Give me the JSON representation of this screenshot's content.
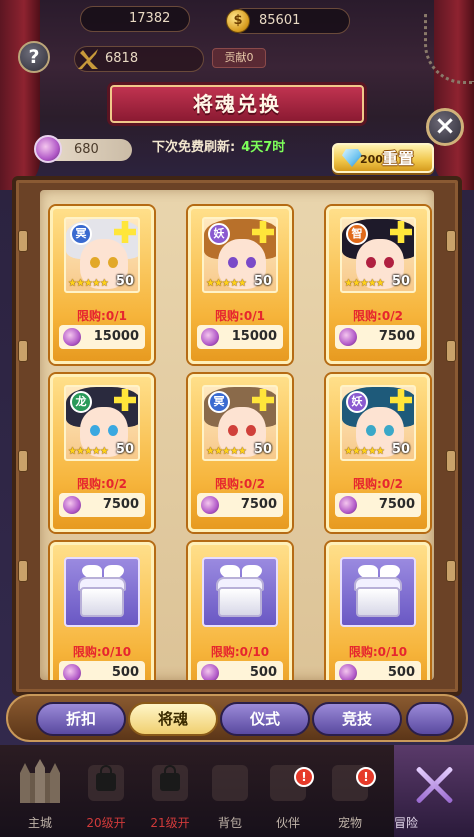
{
  "topbar": {
    "partial_value": "17382",
    "gold": "85601",
    "power": "6818",
    "rank": "贡献0"
  },
  "title": "将魂兑换",
  "soul_balance": "680",
  "refresh": {
    "label": "下次免费刷新:",
    "time": "4天7时"
  },
  "reset": {
    "cost": "200",
    "label": "重置"
  },
  "cards": [
    {
      "faction": "冥",
      "qty": "50",
      "limit": "限购:0/1",
      "price": "15000",
      "hair": "#e4e4ea",
      "eye": "#e2a828",
      "badge": "#3a6ad0"
    },
    {
      "faction": "妖",
      "qty": "50",
      "limit": "限购:0/1",
      "price": "15000",
      "hair": "#b8702a",
      "eye": "#7a4ac8",
      "badge": "#8a5ad0"
    },
    {
      "faction": "智",
      "qty": "50",
      "limit": "限购:0/2",
      "price": "7500",
      "hair": "#1e1a2a",
      "eye": "#b02040",
      "badge": "#e06a1a"
    },
    {
      "faction": "龙",
      "qty": "50",
      "limit": "限购:0/2",
      "price": "7500",
      "hair": "#2a2a3e",
      "eye": "#3aa8e0",
      "badge": "#2a9a5a"
    },
    {
      "faction": "冥",
      "qty": "50",
      "limit": "限购:0/2",
      "price": "7500",
      "hair": "#8a6a4a",
      "eye": "#d0403a",
      "badge": "#3a6ad0"
    },
    {
      "faction": "妖",
      "qty": "50",
      "limit": "限购:0/2",
      "price": "7500",
      "hair": "#1e5a7a",
      "eye": "#3aa8c8",
      "badge": "#8a5ad0"
    },
    {
      "faction": "",
      "qty": "",
      "limit": "限购:0/10",
      "price": "500",
      "chest": true
    },
    {
      "faction": "",
      "qty": "",
      "limit": "限购:0/10",
      "price": "500",
      "chest": true
    },
    {
      "faction": "",
      "qty": "",
      "limit": "限购:0/10",
      "price": "500",
      "chest": true
    }
  ],
  "tabs": [
    {
      "label": "折扣",
      "active": false
    },
    {
      "label": "将魂",
      "active": true
    },
    {
      "label": "仪式",
      "active": false
    },
    {
      "label": "竞技",
      "active": false
    }
  ],
  "nav": [
    {
      "label": "主城",
      "locked": false,
      "alert": false
    },
    {
      "label": "20级开",
      "locked": true,
      "alert": false
    },
    {
      "label": "21级开",
      "locked": true,
      "alert": false
    },
    {
      "label": "背包",
      "locked": false,
      "alert": false
    },
    {
      "label": "伙伴",
      "locked": false,
      "alert": true
    },
    {
      "label": "宠物",
      "locked": false,
      "alert": true
    },
    {
      "label": "冒险",
      "locked": false,
      "alert": false
    }
  ],
  "alert_mark": "!",
  "stars": "★★★★★"
}
